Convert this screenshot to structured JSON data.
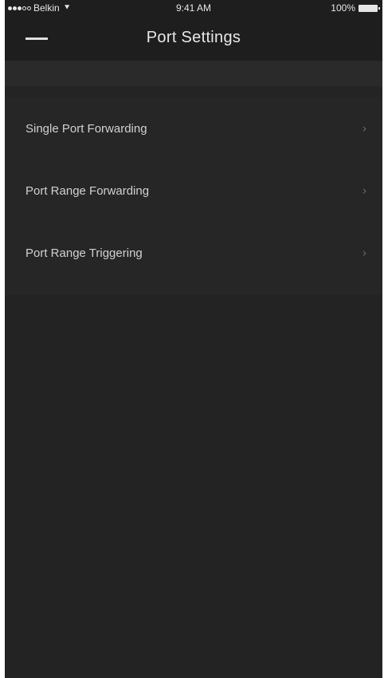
{
  "status_bar": {
    "carrier": "Belkin",
    "time": "9:41 AM",
    "battery": "100%",
    "icons": [
      "signal-dots-icon",
      "wifi-icon",
      "battery-icon"
    ]
  },
  "header": {
    "title": "Port Settings",
    "menu_icon": "hamburger-icon"
  },
  "menu": {
    "items": [
      {
        "label": "Single Port Forwarding",
        "icon": "chevron-right-icon"
      },
      {
        "label": "Port Range Forwarding",
        "icon": "chevron-right-icon"
      },
      {
        "label": "Port Range Triggering",
        "icon": "chevron-right-icon"
      }
    ]
  },
  "colors": {
    "background": "#242424",
    "header": "#1e1e1e",
    "text": "#dcdcdc",
    "chevron": "#6a6a6a"
  }
}
